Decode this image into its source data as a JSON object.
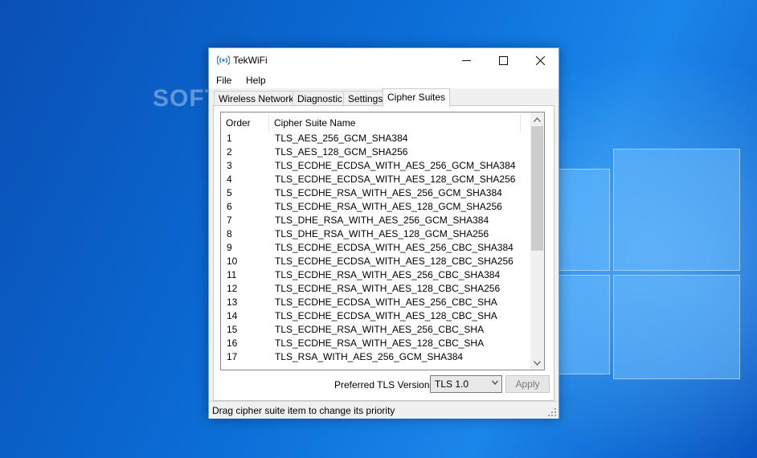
{
  "window": {
    "title": "TekWiFi"
  },
  "watermark": "SOFTPEDIA",
  "menu": [
    {
      "label": "File"
    },
    {
      "label": "Help"
    }
  ],
  "tabs": [
    {
      "label": "Wireless Networks"
    },
    {
      "label": "Diagnostic"
    },
    {
      "label": "Settings"
    },
    {
      "label": "Cipher Suites",
      "active": true
    }
  ],
  "list": {
    "columns": [
      "Order",
      "Cipher Suite Name"
    ],
    "rows": [
      {
        "order": "1",
        "name": "TLS_AES_256_GCM_SHA384"
      },
      {
        "order": "2",
        "name": "TLS_AES_128_GCM_SHA256"
      },
      {
        "order": "3",
        "name": "TLS_ECDHE_ECDSA_WITH_AES_256_GCM_SHA384"
      },
      {
        "order": "4",
        "name": "TLS_ECDHE_ECDSA_WITH_AES_128_GCM_SHA256"
      },
      {
        "order": "5",
        "name": "TLS_ECDHE_RSA_WITH_AES_256_GCM_SHA384"
      },
      {
        "order": "6",
        "name": "TLS_ECDHE_RSA_WITH_AES_128_GCM_SHA256"
      },
      {
        "order": "7",
        "name": "TLS_DHE_RSA_WITH_AES_256_GCM_SHA384"
      },
      {
        "order": "8",
        "name": "TLS_DHE_RSA_WITH_AES_128_GCM_SHA256"
      },
      {
        "order": "9",
        "name": "TLS_ECDHE_ECDSA_WITH_AES_256_CBC_SHA384"
      },
      {
        "order": "10",
        "name": "TLS_ECDHE_ECDSA_WITH_AES_128_CBC_SHA256"
      },
      {
        "order": "11",
        "name": "TLS_ECDHE_RSA_WITH_AES_256_CBC_SHA384"
      },
      {
        "order": "12",
        "name": "TLS_ECDHE_RSA_WITH_AES_128_CBC_SHA256"
      },
      {
        "order": "13",
        "name": "TLS_ECDHE_ECDSA_WITH_AES_256_CBC_SHA"
      },
      {
        "order": "14",
        "name": "TLS_ECDHE_ECDSA_WITH_AES_128_CBC_SHA"
      },
      {
        "order": "15",
        "name": "TLS_ECDHE_RSA_WITH_AES_256_CBC_SHA"
      },
      {
        "order": "16",
        "name": "TLS_ECDHE_RSA_WITH_AES_128_CBC_SHA"
      },
      {
        "order": "17",
        "name": "TLS_RSA_WITH_AES_256_GCM_SHA384"
      }
    ]
  },
  "tls": {
    "label": "Preferred TLS Version:",
    "selected": "TLS 1.0"
  },
  "apply_label": "Apply",
  "status": "Drag cipher suite item to change its priority",
  "icons": {
    "app": "wifi-signal-icon",
    "minimize": "minimize-icon",
    "maximize": "maximize-icon",
    "close": "close-icon",
    "scroll_up": "chevron-up-icon",
    "scroll_down": "chevron-down-icon",
    "dropdown": "chevron-down-icon",
    "grip": "resize-grip-icon"
  },
  "colors": {
    "desktop": "#0b6fd8",
    "window_bg": "#f0f0f0",
    "accent_icon": "#1e78d0"
  }
}
